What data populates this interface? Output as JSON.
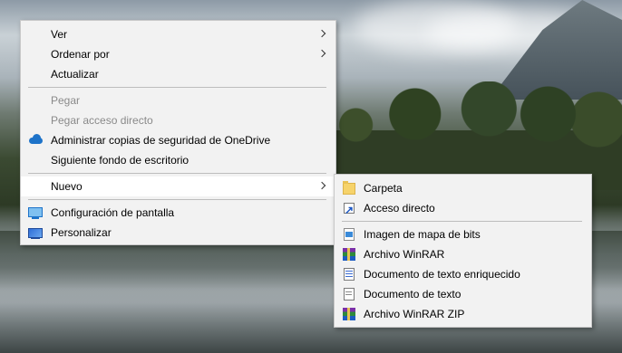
{
  "main_menu": {
    "items": [
      {
        "label": "Ver",
        "has_submenu": true
      },
      {
        "label": "Ordenar por",
        "has_submenu": true
      },
      {
        "label": "Actualizar"
      },
      {
        "label": "Pegar",
        "disabled": true
      },
      {
        "label": "Pegar acceso directo",
        "disabled": true
      },
      {
        "label": "Administrar copias de seguridad de OneDrive",
        "icon": "onedrive-icon"
      },
      {
        "label": "Siguiente fondo de escritorio"
      },
      {
        "label": "Nuevo",
        "has_submenu": true,
        "active": true
      },
      {
        "label": "Configuración de pantalla",
        "icon": "display-settings-icon"
      },
      {
        "label": "Personalizar",
        "icon": "personalize-icon"
      }
    ]
  },
  "new_submenu": {
    "items": [
      {
        "label": "Carpeta",
        "icon": "folder-icon"
      },
      {
        "label": "Acceso directo",
        "icon": "shortcut-icon"
      },
      {
        "label": "Imagen de mapa de bits",
        "icon": "bitmap-image-icon"
      },
      {
        "label": "Archivo WinRAR",
        "icon": "winrar-archive-icon"
      },
      {
        "label": "Documento de texto enriquecido",
        "icon": "rich-text-document-icon"
      },
      {
        "label": "Documento de texto",
        "icon": "text-document-icon"
      },
      {
        "label": "Archivo WinRAR ZIP",
        "icon": "winrar-zip-icon"
      }
    ]
  },
  "colors": {
    "menu_background": "#f2f2f2",
    "menu_border": "#c8c8c8",
    "disabled_text": "#8a8a8a",
    "onedrive_blue": "#1e73c9"
  }
}
